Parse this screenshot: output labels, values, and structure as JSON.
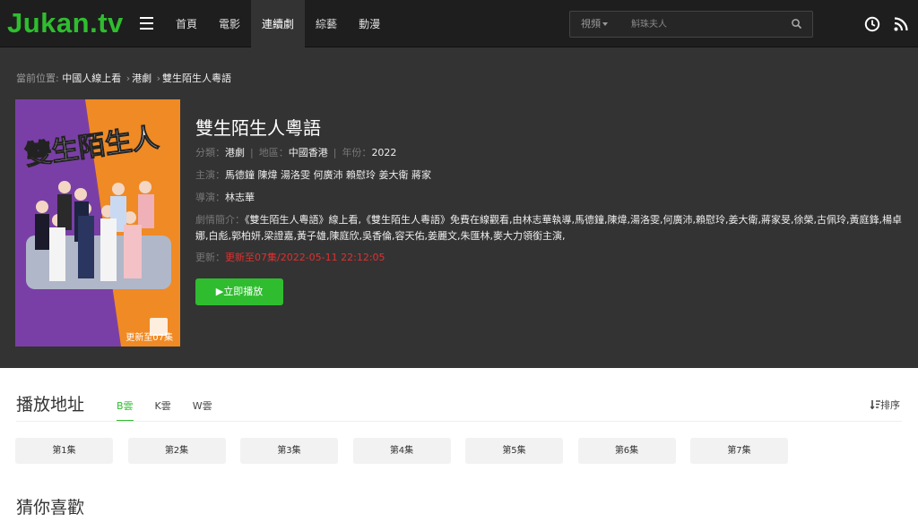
{
  "header": {
    "logo": "Jukan.tv",
    "nav": [
      {
        "label": "首頁",
        "active": false
      },
      {
        "label": "電影",
        "active": false
      },
      {
        "label": "連續劇",
        "active": true
      },
      {
        "label": "綜藝",
        "active": false
      },
      {
        "label": "動漫",
        "active": false
      }
    ],
    "search": {
      "type_label": "視頻",
      "placeholder": "斛珠夫人",
      "icon": "search-icon"
    },
    "icons": [
      "history-icon",
      "rss-icon"
    ]
  },
  "breadcrumb": {
    "prefix": "當前位置:",
    "items": [
      "中國人線上看",
      "港劇",
      "雙生陌生人粵語"
    ],
    "separator": "›"
  },
  "poster": {
    "title_art": "雙生陌生人",
    "badge": "更新至07集",
    "colors": {
      "left": "#7a3fa6",
      "right": "#f08a24",
      "sofa": "#b0b7c8"
    }
  },
  "detail": {
    "title": "雙生陌生人粵語",
    "category_label": "分類：",
    "category": "港劇",
    "region_label": "地區：",
    "region": "中國香港",
    "year_label": "年份：",
    "year": "2022",
    "cast_label": "主演：",
    "cast": "馬德鐘 陳煒 湯洛雯 何廣沛 賴慰玲 姜大衛 蔣家",
    "director_label": "導演：",
    "director": "林志華",
    "plot_label": "劇情簡介：",
    "plot": "《雙生陌生人粵語》線上看,《雙生陌生人粵語》免費在線觀看,由林志華執導,馬德鐘,陳煒,湯洛雯,何廣沛,賴慰玲,姜大衛,蔣家旻,徐榮,古佩玲,黃庭鋒,楊卓娜,白彪,郭柏妍,梁證嘉,黃子雄,陳庭欣,吳香倫,容天佑,姜麗文,朱匯林,麥大力領銜主演,",
    "update_label": "更新：",
    "update": "更新至07集/2022-05-11 22:12:05",
    "play_button": "▶立即播放"
  },
  "sources": {
    "title": "播放地址",
    "tabs": [
      {
        "label": "B雲",
        "active": true
      },
      {
        "label": "K雲",
        "active": false
      },
      {
        "label": "W雲",
        "active": false
      }
    ],
    "sort_label": "排序",
    "episodes": [
      "第1集",
      "第2集",
      "第3集",
      "第4集",
      "第5集",
      "第6集",
      "第7集"
    ]
  },
  "recommend": {
    "title": "猜你喜歡"
  },
  "colors": {
    "accent": "#2fbd2f",
    "header_bg": "#1e1e1e",
    "detail_bg": "#333333",
    "update_red": "#e03030"
  }
}
